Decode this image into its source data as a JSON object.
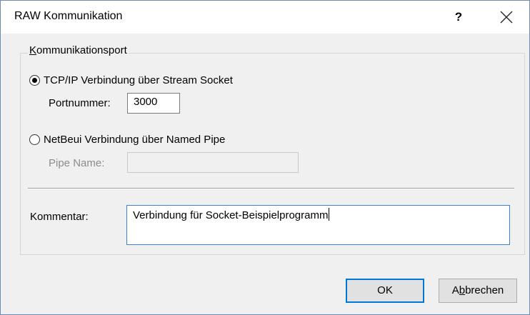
{
  "window": {
    "title": "RAW Kommunikation",
    "help_label": "?",
    "close_icon": "close-icon"
  },
  "group": {
    "legend_prefix": "K",
    "legend_rest": "ommunikationsport"
  },
  "tcp": {
    "label": "TCP/IP Verbindung über Stream Socket",
    "selected": true,
    "port_label": "Portnummer:",
    "port_value": "3000"
  },
  "netbeui": {
    "label": "NetBeui Verbindung über Named Pipe",
    "selected": false,
    "pipe_label": "Pipe Name:",
    "pipe_value": ""
  },
  "comment": {
    "label": "Kommentar:",
    "value": "Verbindung für Socket-Beispielprogramm"
  },
  "buttons": {
    "ok_label": "OK",
    "cancel_prefix": "A",
    "cancel_mnemonic": "b",
    "cancel_rest": "brechen"
  },
  "colors": {
    "accent": "#0078d7",
    "window_border": "#6b8bb5",
    "background": "#f0f0f0"
  }
}
